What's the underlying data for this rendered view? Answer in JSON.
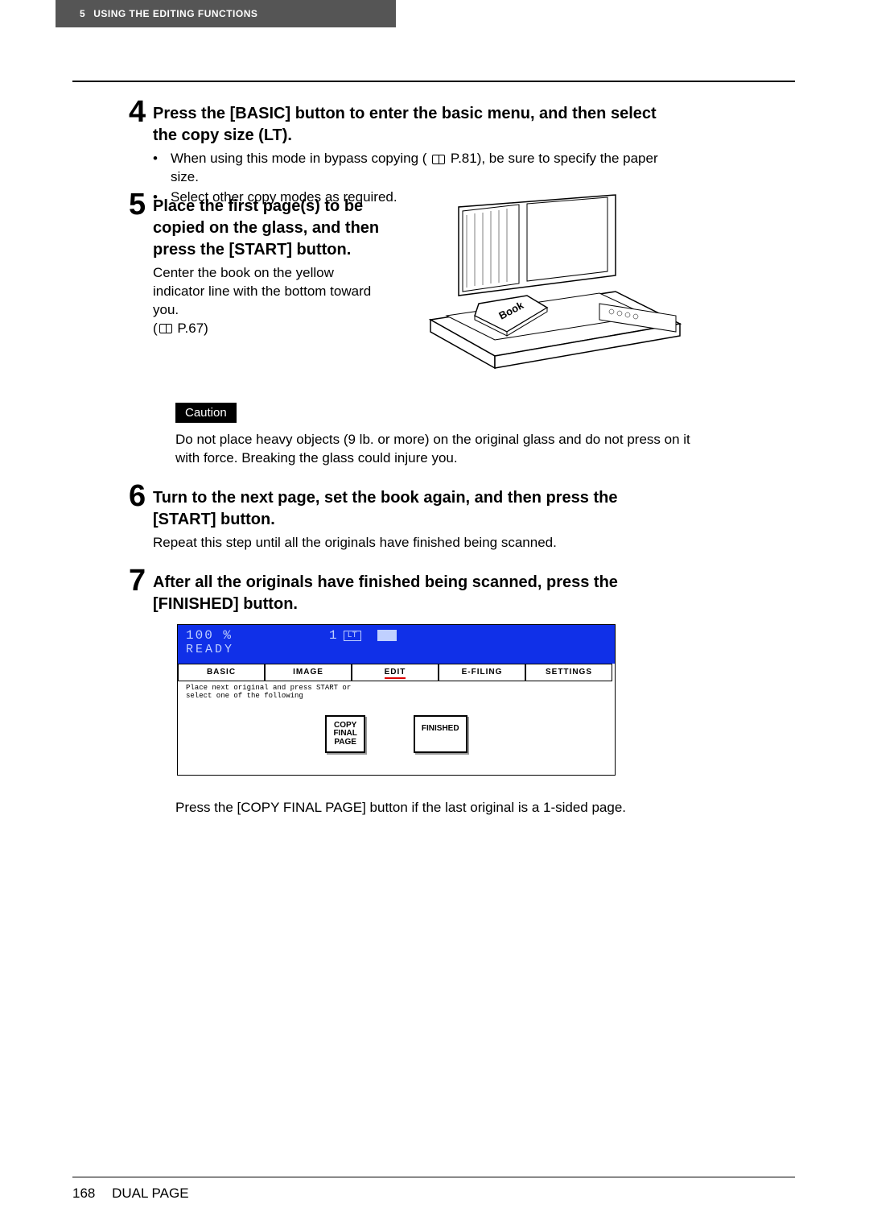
{
  "header": {
    "chapter_num": "5",
    "chapter_title": "USING THE EDITING FUNCTIONS"
  },
  "steps": {
    "s4": {
      "num": "4",
      "title": "Press the [BASIC] button to enter the basic menu, and then select the copy size (LT).",
      "bullet1_a": "When using this mode in bypass copying (",
      "bullet1_b": " P.81), be sure to specify the paper size.",
      "bullet2": "Select other copy modes as required."
    },
    "s5": {
      "num": "5",
      "title": "Place the first page(s) to be copied on the glass, and then press the [START] button.",
      "body_a": "Center the book on the yellow indicator line with the bottom toward you.",
      "body_b": "(",
      "body_c": " P.67)"
    },
    "caution": {
      "label": "Caution",
      "text": "Do not place heavy objects (9 lb. or more) on the original glass and do not press on it with force. Breaking the glass could injure you."
    },
    "s6": {
      "num": "6",
      "title": "Turn to the next page, set the book again, and then press the [START] button.",
      "body": "Repeat this step until all the originals have finished being scanned."
    },
    "s7": {
      "num": "7",
      "title": "After all the originals have finished being scanned, press the [FINISHED] button.",
      "body_after": "Press the [COPY FINAL PAGE] button if the last original is a 1-sided page."
    }
  },
  "screen": {
    "percent": "100",
    "percent_sym": "%",
    "ready": "READY",
    "count": "1",
    "lt": "LT",
    "tabs": {
      "basic": "BASIC",
      "image": "IMAGE",
      "edit": "EDIT",
      "efiling": "E-FILING",
      "settings": "SETTINGS"
    },
    "msg1": "Place next original and press START or",
    "msg2": "select one of the following",
    "btn_copy_final_l1": "COPY",
    "btn_copy_final_l2": "FINAL",
    "btn_copy_final_l3": "PAGE",
    "btn_finished": "FINISHED"
  },
  "footer": {
    "page": "168",
    "section": "DUAL PAGE"
  }
}
